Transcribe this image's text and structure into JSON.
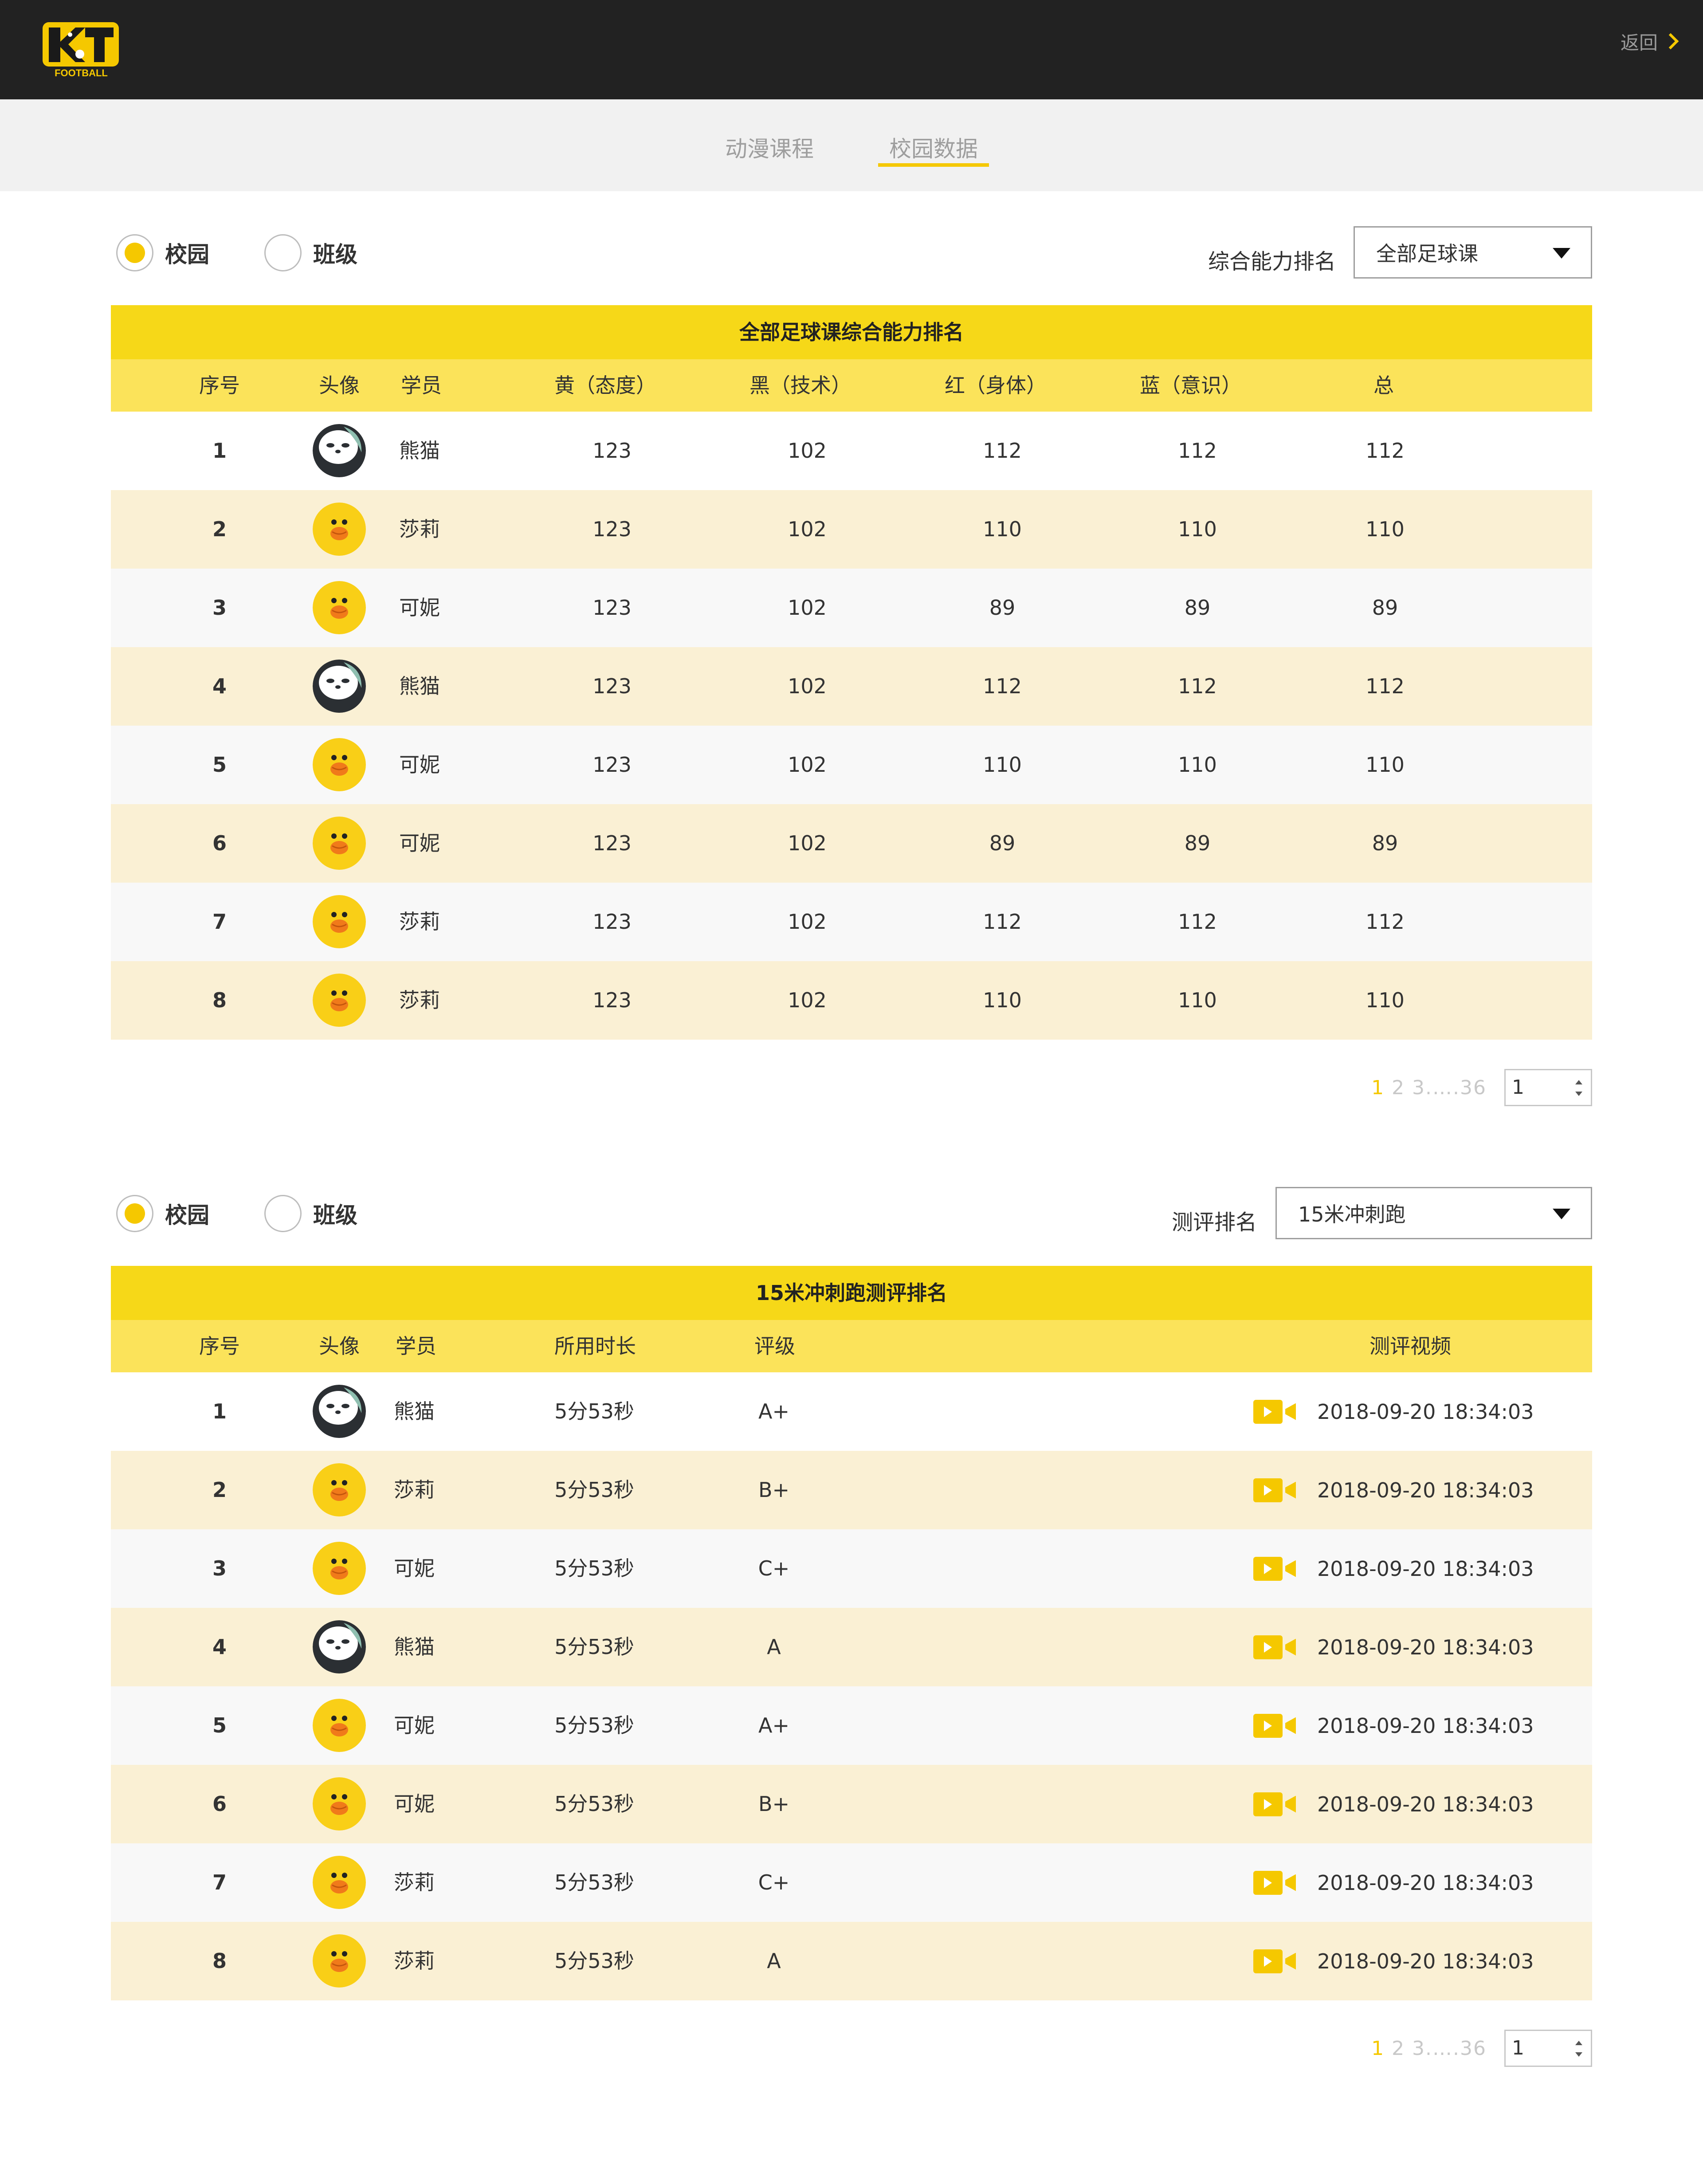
{
  "header": {
    "logo_text": "FOOTBALL",
    "back_label": "返回"
  },
  "tabs": [
    {
      "label": "动漫课程",
      "active": false
    },
    {
      "label": "校园数据",
      "active": true
    }
  ],
  "colors": {
    "accent": "#f5c800",
    "header_bg": "#222222",
    "row_alt": "#faf0d4",
    "title_bar": "#f6d818",
    "head_bar": "#fbe35a"
  },
  "ability": {
    "radio": {
      "campus": "校园",
      "class": "班级",
      "selected": "campus"
    },
    "rank_label": "综合能力排名",
    "select_value": "全部足球课",
    "title": "全部足球课综合能力排名",
    "headers": [
      "序号",
      "头像",
      "学员",
      "黄（态度）",
      "黑（技术）",
      "红（身体）",
      "蓝（意识）",
      "总"
    ],
    "rows": [
      {
        "no": "1",
        "avatar": "panda-avatar",
        "name": "熊猫",
        "yellow": "123",
        "black": "102",
        "red": "112",
        "blue": "112",
        "total": "112"
      },
      {
        "no": "2",
        "avatar": "chick-avatar",
        "name": "莎莉",
        "yellow": "123",
        "black": "102",
        "red": "110",
        "blue": "110",
        "total": "110"
      },
      {
        "no": "3",
        "avatar": "chick-avatar",
        "name": "可妮",
        "yellow": "123",
        "black": "102",
        "red": "89",
        "blue": "89",
        "total": "89"
      },
      {
        "no": "4",
        "avatar": "panda-avatar",
        "name": "熊猫",
        "yellow": "123",
        "black": "102",
        "red": "112",
        "blue": "112",
        "total": "112"
      },
      {
        "no": "5",
        "avatar": "chick-avatar",
        "name": "可妮",
        "yellow": "123",
        "black": "102",
        "red": "110",
        "blue": "110",
        "total": "110"
      },
      {
        "no": "6",
        "avatar": "chick-avatar",
        "name": "可妮",
        "yellow": "123",
        "black": "102",
        "red": "89",
        "blue": "89",
        "total": "89"
      },
      {
        "no": "7",
        "avatar": "chick-avatar",
        "name": "莎莉",
        "yellow": "123",
        "black": "102",
        "red": "112",
        "blue": "112",
        "total": "112"
      },
      {
        "no": "8",
        "avatar": "chick-avatar",
        "name": "莎莉",
        "yellow": "123",
        "black": "102",
        "red": "110",
        "blue": "110",
        "total": "110"
      }
    ],
    "pager": {
      "current": "1",
      "rest": " 2 3.….36",
      "input": "1"
    }
  },
  "sprint": {
    "radio": {
      "campus": "校园",
      "class": "班级",
      "selected": "campus"
    },
    "rank_label": "测评排名",
    "select_value": "15米冲刺跑",
    "title": "15米冲刺跑测评排名",
    "headers": [
      "序号",
      "头像",
      "学员",
      "所用时长",
      "评级",
      "测评视频"
    ],
    "rows": [
      {
        "no": "1",
        "avatar": "panda-avatar",
        "name": "熊猫",
        "duration": "5分53秒",
        "grade": "A+",
        "video_time": "2018-09-20 18:34:03"
      },
      {
        "no": "2",
        "avatar": "chick-avatar",
        "name": "莎莉",
        "duration": "5分53秒",
        "grade": "B+",
        "video_time": "2018-09-20 18:34:03"
      },
      {
        "no": "3",
        "avatar": "chick-avatar",
        "name": "可妮",
        "duration": "5分53秒",
        "grade": "C+",
        "video_time": "2018-09-20 18:34:03"
      },
      {
        "no": "4",
        "avatar": "panda-avatar",
        "name": "熊猫",
        "duration": "5分53秒",
        "grade": "A",
        "video_time": "2018-09-20 18:34:03"
      },
      {
        "no": "5",
        "avatar": "chick-avatar",
        "name": "可妮",
        "duration": "5分53秒",
        "grade": "A+",
        "video_time": "2018-09-20 18:34:03"
      },
      {
        "no": "6",
        "avatar": "chick-avatar",
        "name": "可妮",
        "duration": "5分53秒",
        "grade": "B+",
        "video_time": "2018-09-20 18:34:03"
      },
      {
        "no": "7",
        "avatar": "chick-avatar",
        "name": "莎莉",
        "duration": "5分53秒",
        "grade": "C+",
        "video_time": "2018-09-20 18:34:03"
      },
      {
        "no": "8",
        "avatar": "chick-avatar",
        "name": "莎莉",
        "duration": "5分53秒",
        "grade": "A",
        "video_time": "2018-09-20 18:34:03"
      }
    ],
    "pager": {
      "current": "1",
      "rest": " 2 3.….36",
      "input": "1"
    }
  }
}
